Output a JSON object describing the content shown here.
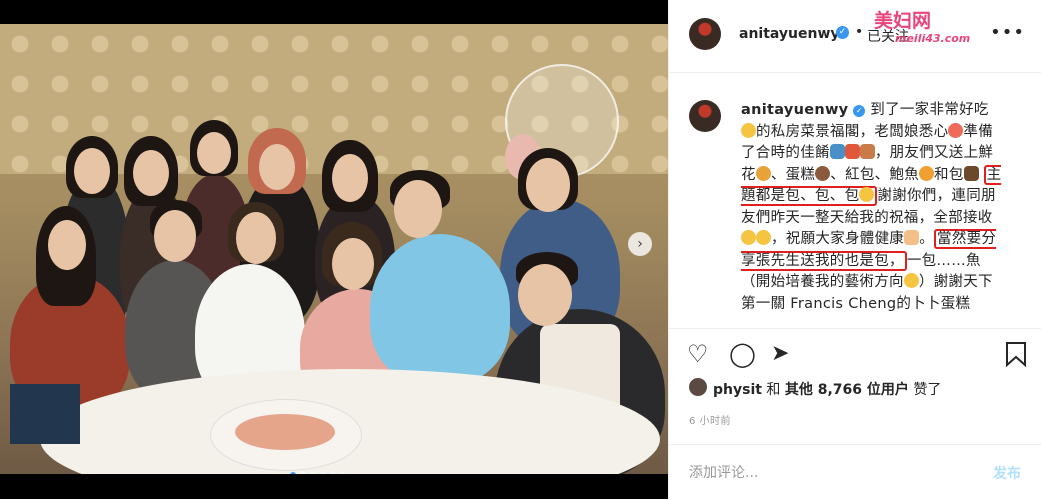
{
  "post": {
    "username": "anitayuenwy",
    "follow_state": "已关注",
    "header_separator": "•",
    "watermark": "美妇网",
    "watermark_sub": "meili43.com",
    "caption": {
      "part1": "到了一家非常好吃",
      "part2": "的私房菜景福閣，老闆娘悉心",
      "part3": "準備了合時的佳餚",
      "part4": "，朋友們又送上鮮花",
      "part5": "、蛋糕",
      "part6": "、紅包",
      "part7": "、鮑魚",
      "part8": "和包",
      "highlight1": "主題都是包、包、包",
      "part9": "謝謝你們，連同朋友們昨天一整天給我的祝福，全部接收",
      "part10": "，祝願大家身體健康",
      "part11": "。",
      "highlight2": "當然要分享張先生送我的也是包，",
      "part12": "一包……魚（開始培養我的藝術方向",
      "part13": "）謝謝天下第一關 Francis Cheng的卜卜蛋糕"
    },
    "likes": {
      "liker": "physit",
      "connector": "和",
      "others": "其他 8,766 位用户",
      "suffix": "赞了"
    },
    "time": "6 小时前",
    "comment": {
      "placeholder": "添加评论...",
      "post_label": "发布"
    }
  },
  "icons": {
    "like": "heart-icon",
    "comment": "comment-icon",
    "share": "share-icon",
    "save": "bookmark-icon",
    "more": "more-icon",
    "verified": "verified-icon",
    "next": "chevron-right-icon"
  },
  "colors": {
    "verified": "#3897f0",
    "highlight_border": "#e0201f",
    "watermark": "#e8457c",
    "post_disabled": "#b2dffc"
  }
}
